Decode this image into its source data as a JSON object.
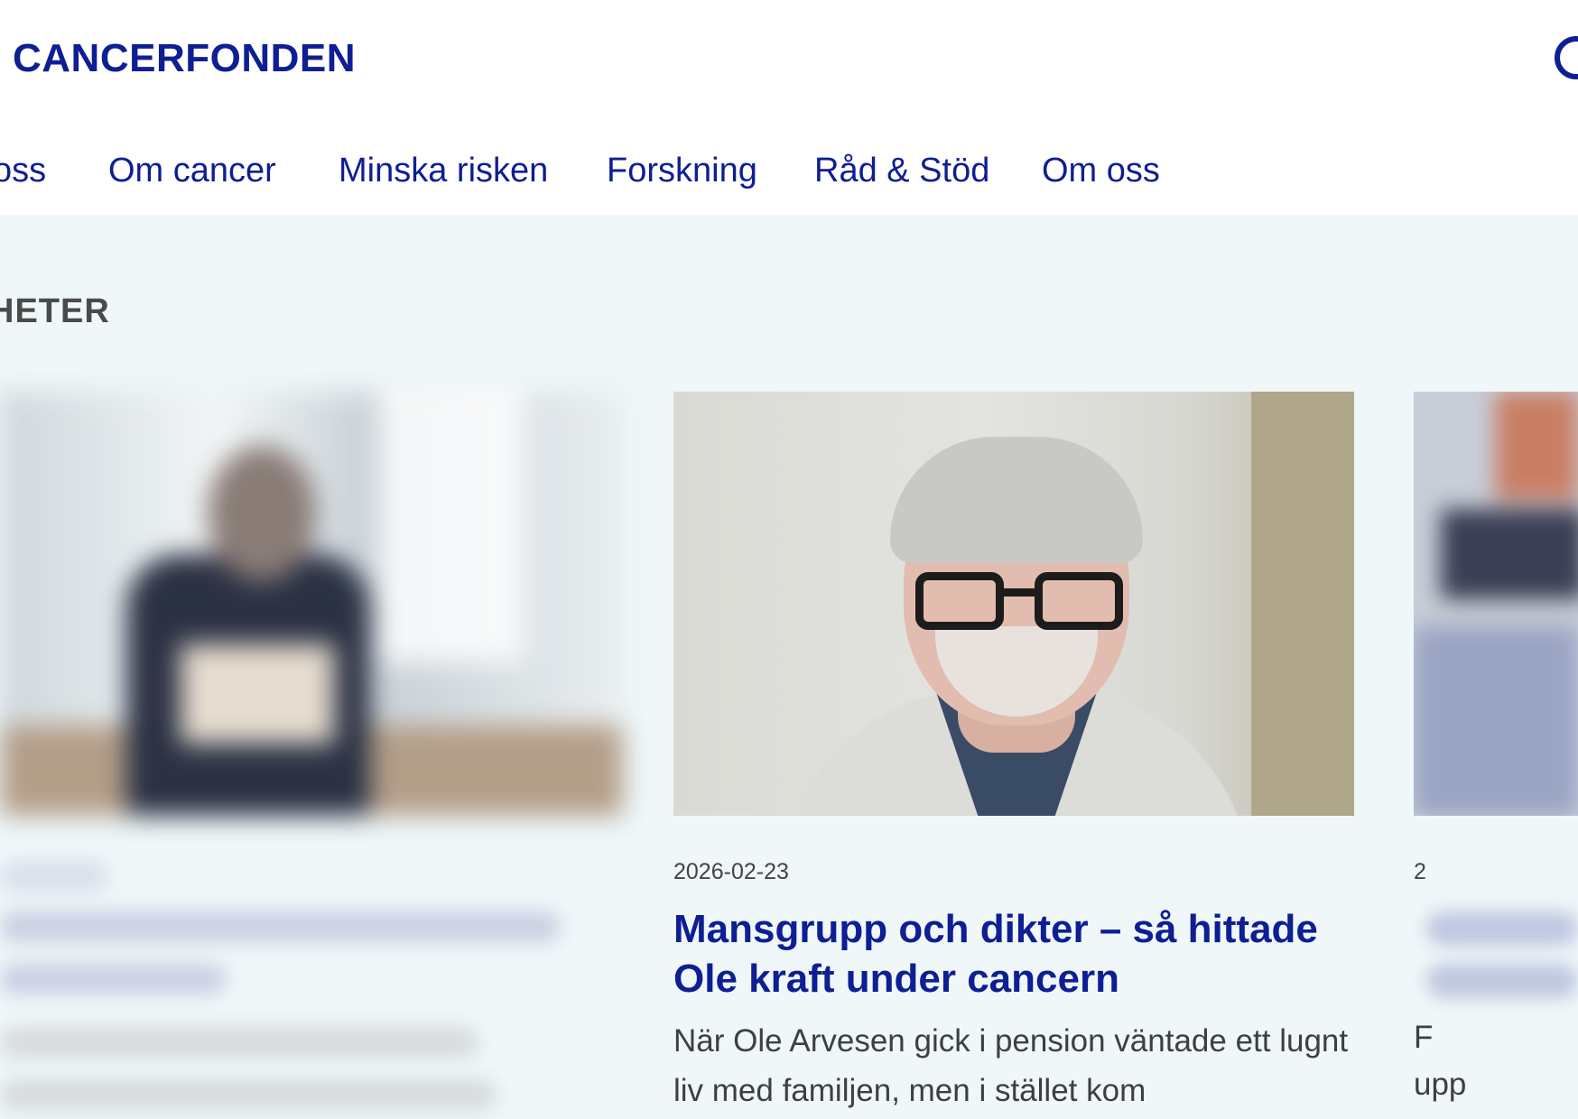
{
  "header": {
    "logo_text": "CANCERFONDEN",
    "brand_color": "#0e1e93"
  },
  "nav": {
    "items": [
      {
        "label": "oss"
      },
      {
        "label": "Om cancer"
      },
      {
        "label": "Minska risken"
      },
      {
        "label": "Forskning"
      },
      {
        "label": "Råd & Stöd"
      },
      {
        "label": "Om oss"
      }
    ]
  },
  "section": {
    "title": "HETER"
  },
  "cards": {
    "featured": {
      "date": "2026-02-23",
      "title": "Mansgrupp och dikter – så hittade Ole kraft under cancern",
      "excerpt": "När Ole Arvesen gick i pension väntade ett lugnt liv med familjen, men i stället kom"
    },
    "right": {
      "date_fragment": "2",
      "text_fragment_1": "F",
      "text_fragment_2": "upp"
    }
  },
  "icons": {
    "search": "search-icon"
  }
}
